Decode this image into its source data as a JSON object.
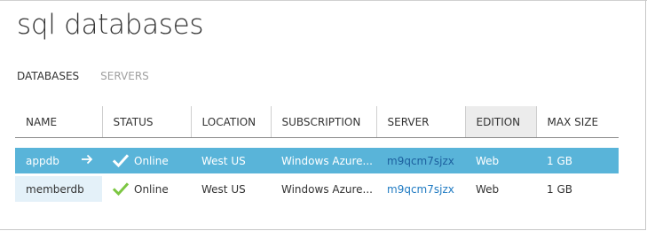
{
  "page": {
    "title": "sql databases"
  },
  "tabs": [
    {
      "label": "DATABASES"
    },
    {
      "label": "SERVERS"
    }
  ],
  "table": {
    "columns": [
      "NAME",
      "STATUS",
      "LOCATION",
      "SUBSCRIPTION",
      "SERVER",
      "EDITION",
      "MAX SIZE"
    ],
    "rows": [
      {
        "name": "appdb",
        "status": "Online",
        "location": "West US",
        "subscription": "Windows Azure...",
        "server": "m9qcm7sjzx",
        "edition": "Web",
        "max_size": "1 GB"
      },
      {
        "name": "memberdb",
        "status": "Online",
        "location": "West US",
        "subscription": "Windows Azure...",
        "server": "m9qcm7sjzx",
        "edition": "Web",
        "max_size": "1 GB"
      }
    ]
  },
  "icons": {
    "status_online": "checkmark-icon",
    "open_row": "arrow-right-icon"
  },
  "colors": {
    "selected_row": "#59b4d9",
    "online_check": "#7cc642",
    "server_link": "#1f7ac2",
    "name_cell_bg": "#e4f1f9"
  }
}
